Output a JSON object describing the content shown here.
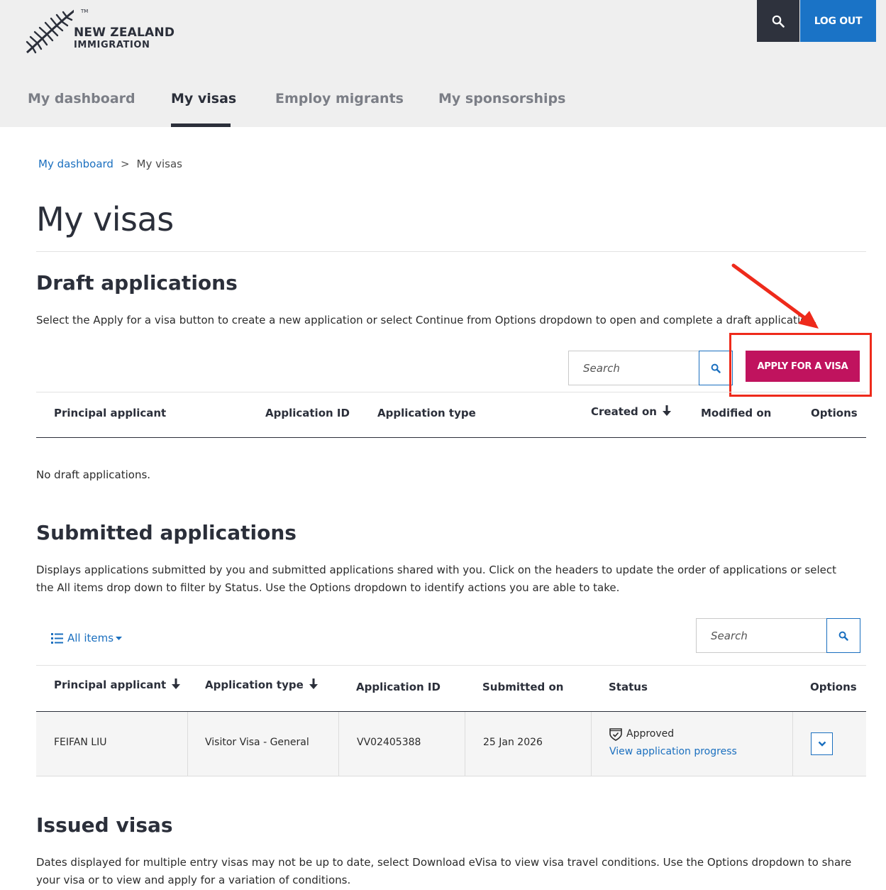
{
  "brand": {
    "line1": "NEW ZEALAND",
    "line2": "IMMIGRATION",
    "tm": "TM"
  },
  "header": {
    "logout_label": "LOG OUT"
  },
  "nav": {
    "tabs": [
      {
        "label": "My dashboard"
      },
      {
        "label": "My visas"
      },
      {
        "label": "Employ migrants"
      },
      {
        "label": "My sponsorships"
      }
    ],
    "active": "My visas"
  },
  "breadcrumb": {
    "link": "My dashboard",
    "separator": ">",
    "current": "My visas"
  },
  "page": {
    "title": "My visas"
  },
  "drafts": {
    "title": "Draft applications",
    "description": "Select the Apply for a visa button to create a new application or select Continue from Options dropdown to open and complete a draft application.",
    "search_placeholder": "Search",
    "apply_label": "APPLY FOR A VISA",
    "columns": [
      "Principal applicant",
      "Application ID",
      "Application type",
      "Created on",
      "Modified on",
      "Options"
    ],
    "empty_message": "No draft applications."
  },
  "submitted": {
    "title": "Submitted applications",
    "description": "Displays applications submitted by you and submitted applications shared with you. Click on the headers to update the order of applications or select the All items drop down to filter by Status. Use the Options dropdown to identify actions you are able to take.",
    "filter_label": "All items",
    "search_placeholder": "Search",
    "columns": [
      "Principal applicant",
      "Application type",
      "Application ID",
      "Submitted on",
      "Status",
      "Options"
    ],
    "rows": [
      {
        "applicant": "FEIFAN LIU",
        "type": "Visitor Visa - General",
        "id": "VV02405388",
        "submitted_on": "25 Jan 2026",
        "status": "Approved",
        "progress_link": "View application progress"
      }
    ]
  },
  "issued": {
    "title": "Issued visas",
    "description": "Dates displayed for multiple entry visas may not be up to date, select Download eVisa to view visa travel conditions. Use the Options dropdown to share your visa or to view and apply for a variation of conditions."
  },
  "colors": {
    "header_bg": "#efefef",
    "dark": "#2e323d",
    "blue": "#1a73c6",
    "link": "#1a6fbf",
    "apply": "#c0135e",
    "annotation": "#ee2a1b"
  }
}
